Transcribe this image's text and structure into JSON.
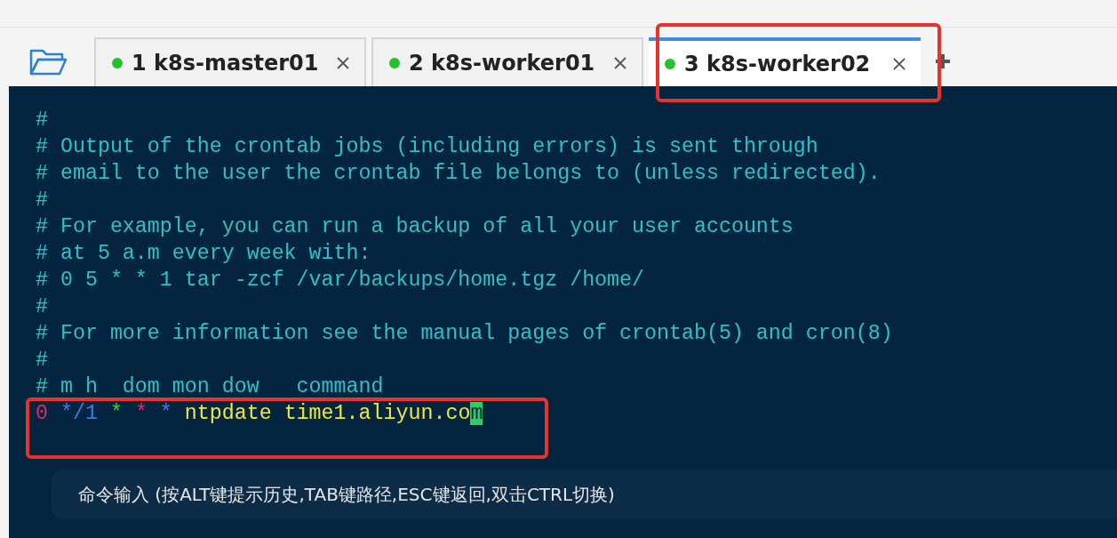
{
  "tabs": [
    {
      "label": "1 k8s-master01",
      "selected": false,
      "connected": true
    },
    {
      "label": "2 k8s-worker01",
      "selected": false,
      "connected": true
    },
    {
      "label": "3 k8s-worker02",
      "selected": true,
      "connected": true
    }
  ],
  "terminal": {
    "lines": [
      {
        "tokens": [
          {
            "text": "#",
            "color": "#2fc1c7"
          }
        ]
      },
      {
        "tokens": [
          {
            "text": "# Output of the crontab jobs (including errors) is sent through",
            "color": "#2fc1c7"
          }
        ]
      },
      {
        "tokens": [
          {
            "text": "# email to the user the crontab file belongs to (unless redirected).",
            "color": "#2fc1c7"
          }
        ]
      },
      {
        "tokens": [
          {
            "text": "#",
            "color": "#2fc1c7"
          }
        ]
      },
      {
        "tokens": [
          {
            "text": "# For example, you can run a backup of all your user accounts",
            "color": "#2fc1c7"
          }
        ]
      },
      {
        "tokens": [
          {
            "text": "# at 5 a.m every week with:",
            "color": "#2fc1c7"
          }
        ]
      },
      {
        "tokens": [
          {
            "text": "# 0 5 * * 1 tar -zcf /var/backups/home.tgz /home/",
            "color": "#2fc1c7"
          }
        ]
      },
      {
        "tokens": [
          {
            "text": "#",
            "color": "#2fc1c7"
          }
        ]
      },
      {
        "tokens": [
          {
            "text": "# For more information see the manual pages of crontab(5) and cron(8)",
            "color": "#2fc1c7"
          }
        ]
      },
      {
        "tokens": [
          {
            "text": "#",
            "color": "#2fc1c7"
          }
        ]
      },
      {
        "tokens": [
          {
            "text": "# m h  dom mon dow   command",
            "color": "#2fc1c7"
          }
        ]
      },
      {
        "tokens": [
          {
            "kind": "word",
            "text": "0",
            "color": "#e0286e"
          },
          {
            "kind": "word",
            "text": "*/1",
            "color": "#3b7de0"
          },
          {
            "kind": "word",
            "text": "*",
            "color": "#38d33a"
          },
          {
            "kind": "word",
            "text": "*",
            "color": "#e0286e"
          },
          {
            "kind": "word",
            "text": "*",
            "color": "#3b7de0"
          },
          {
            "kind": "word",
            "text": "ntpdate time1.aliyun.co",
            "color": "#f2e83a"
          },
          {
            "kind": "cursor",
            "text": "m",
            "color": "#2fce5e"
          }
        ]
      }
    ]
  },
  "command_input": {
    "placeholder": "命令输入 (按ALT键提示历史,TAB键路径,ESC键返回,双击CTRL切换)"
  }
}
